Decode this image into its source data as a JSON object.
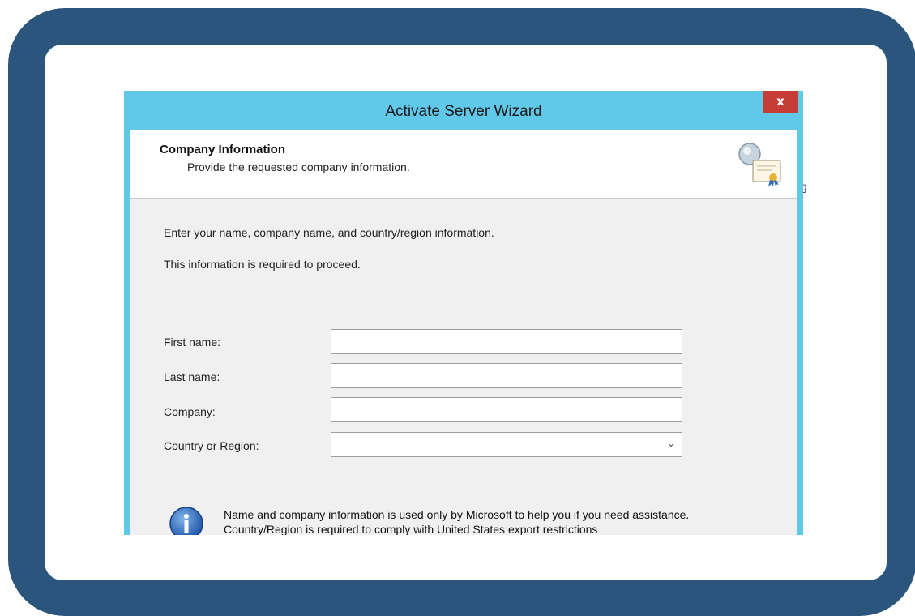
{
  "dialog": {
    "title": "Activate Server Wizard",
    "close_label": "x"
  },
  "header": {
    "title": "Company Information",
    "subtitle": "Provide the requested company information."
  },
  "body": {
    "instruction": "Enter your name, company name, and country/region information.",
    "required_note": "This information is required to proceed."
  },
  "form": {
    "first_name": {
      "label": "First name:",
      "value": ""
    },
    "last_name": {
      "label": "Last name:",
      "value": ""
    },
    "company": {
      "label": "Company:",
      "value": ""
    },
    "country": {
      "label": "Country or Region:",
      "value": ""
    }
  },
  "info": {
    "text": "Name and company information is used only by Microsoft to help you if you need assistance. Country/Region is required to comply with United States export restrictions"
  },
  "background": {
    "partial_text": "",
    "partial_char": "g"
  },
  "colors": {
    "frame": "#2b557c",
    "titlebar": "#60c8e8",
    "close": "#c63d36"
  }
}
